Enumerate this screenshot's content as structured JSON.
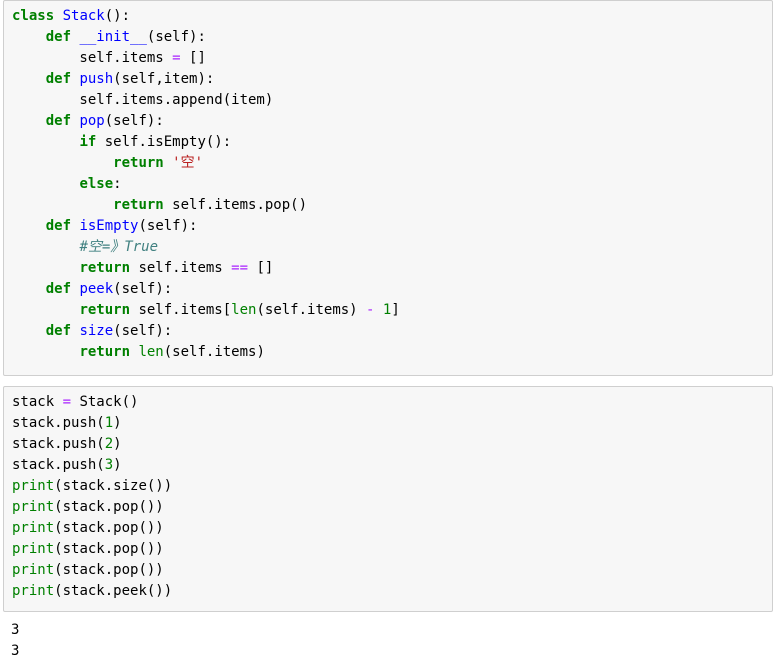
{
  "cells": [
    {
      "lines": [
        [
          {
            "t": "class",
            "c": "kw"
          },
          {
            "t": " "
          },
          {
            "t": "Stack",
            "c": "cls"
          },
          {
            "t": "():"
          }
        ],
        [
          {
            "t": "    "
          },
          {
            "t": "def",
            "c": "kw"
          },
          {
            "t": " "
          },
          {
            "t": "__init__",
            "c": "fn"
          },
          {
            "t": "(self):"
          }
        ],
        [
          {
            "t": "        self.items "
          },
          {
            "t": "=",
            "c": "op"
          },
          {
            "t": " []"
          }
        ],
        [
          {
            "t": "    "
          },
          {
            "t": "def",
            "c": "kw"
          },
          {
            "t": " "
          },
          {
            "t": "push",
            "c": "fn"
          },
          {
            "t": "(self,item):"
          }
        ],
        [
          {
            "t": "        self.items.append(item)"
          }
        ],
        [
          {
            "t": "    "
          },
          {
            "t": "def",
            "c": "kw"
          },
          {
            "t": " "
          },
          {
            "t": "pop",
            "c": "fn"
          },
          {
            "t": "(self):"
          }
        ],
        [
          {
            "t": "        "
          },
          {
            "t": "if",
            "c": "kw"
          },
          {
            "t": " self.isEmpty():"
          }
        ],
        [
          {
            "t": "            "
          },
          {
            "t": "return",
            "c": "kw"
          },
          {
            "t": " "
          },
          {
            "t": "'空'",
            "c": "str"
          }
        ],
        [
          {
            "t": "        "
          },
          {
            "t": "else",
            "c": "kw"
          },
          {
            "t": ":"
          }
        ],
        [
          {
            "t": "            "
          },
          {
            "t": "return",
            "c": "kw"
          },
          {
            "t": " self.items.pop()"
          }
        ],
        [
          {
            "t": "    "
          },
          {
            "t": "def",
            "c": "kw"
          },
          {
            "t": " "
          },
          {
            "t": "isEmpty",
            "c": "fn"
          },
          {
            "t": "(self):"
          }
        ],
        [
          {
            "t": "        "
          },
          {
            "t": "#空=》True",
            "c": "cm"
          }
        ],
        [
          {
            "t": "        "
          },
          {
            "t": "return",
            "c": "kw"
          },
          {
            "t": " self.items "
          },
          {
            "t": "==",
            "c": "op"
          },
          {
            "t": " []"
          }
        ],
        [
          {
            "t": "    "
          },
          {
            "t": "def",
            "c": "kw"
          },
          {
            "t": " "
          },
          {
            "t": "peek",
            "c": "fn"
          },
          {
            "t": "(self):"
          }
        ],
        [
          {
            "t": "        "
          },
          {
            "t": "return",
            "c": "kw"
          },
          {
            "t": " self.items["
          },
          {
            "t": "len",
            "c": "bi"
          },
          {
            "t": "(self.items) "
          },
          {
            "t": "-",
            "c": "op"
          },
          {
            "t": " "
          },
          {
            "t": "1",
            "c": "num"
          },
          {
            "t": "]"
          }
        ],
        [
          {
            "t": "    "
          },
          {
            "t": "def",
            "c": "kw"
          },
          {
            "t": " "
          },
          {
            "t": "size",
            "c": "fn"
          },
          {
            "t": "(self):"
          }
        ],
        [
          {
            "t": "        "
          },
          {
            "t": "return",
            "c": "kw"
          },
          {
            "t": " "
          },
          {
            "t": "len",
            "c": "bi"
          },
          {
            "t": "(self.items)"
          }
        ]
      ]
    },
    {
      "lines": [
        [
          {
            "t": "stack "
          },
          {
            "t": "=",
            "c": "op"
          },
          {
            "t": " Stack()"
          }
        ],
        [
          {
            "t": "stack.push("
          },
          {
            "t": "1",
            "c": "num"
          },
          {
            "t": ")"
          }
        ],
        [
          {
            "t": "stack.push("
          },
          {
            "t": "2",
            "c": "num"
          },
          {
            "t": ")"
          }
        ],
        [
          {
            "t": "stack.push("
          },
          {
            "t": "3",
            "c": "num"
          },
          {
            "t": ")"
          }
        ],
        [
          {
            "t": "print",
            "c": "bi"
          },
          {
            "t": "(stack.size())"
          }
        ],
        [
          {
            "t": "print",
            "c": "bi"
          },
          {
            "t": "(stack.pop())"
          }
        ],
        [
          {
            "t": "print",
            "c": "bi"
          },
          {
            "t": "(stack.pop())"
          }
        ],
        [
          {
            "t": "print",
            "c": "bi"
          },
          {
            "t": "(stack.pop())"
          }
        ],
        [
          {
            "t": "print",
            "c": "bi"
          },
          {
            "t": "(stack.pop())"
          }
        ],
        [
          {
            "t": "print",
            "c": "bi"
          },
          {
            "t": "(stack.peek())"
          }
        ]
      ]
    }
  ],
  "output": [
    "3",
    "3"
  ]
}
